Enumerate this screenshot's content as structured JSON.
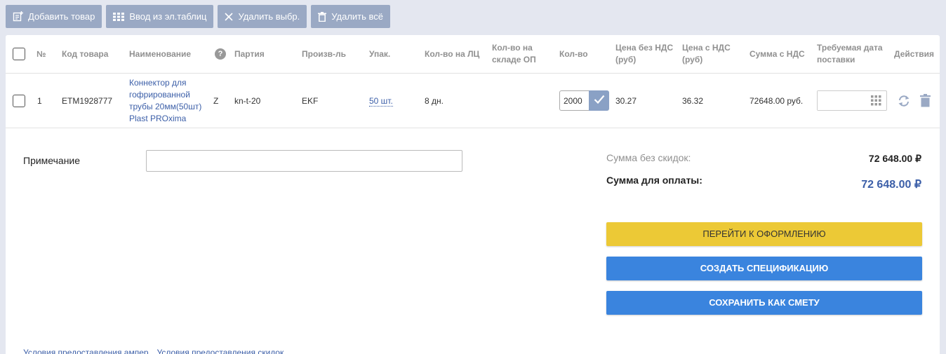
{
  "toolbar": {
    "add_label": "Добавить товар",
    "import_label": "Ввод из эл.таблиц",
    "delete_selected_label": "Удалить выбр.",
    "delete_all_label": "Удалить всё"
  },
  "table": {
    "headers": {
      "num": "№",
      "code": "Код товара",
      "name": "Наименование",
      "help": "?",
      "batch": "Партия",
      "manufacturer": "Произв-ль",
      "pack": "Упак.",
      "qty_lc": "Кол-во на ЛЦ",
      "qty_stock": "Кол-во на складе ОП",
      "qty": "Кол-во",
      "price_no_vat": "Цена без НДС (руб)",
      "price_vat": "Цена с НДС (руб)",
      "sum_vat": "Сумма с НДС",
      "delivery_date": "Требуемая дата поставки",
      "actions": "Действия"
    },
    "rows": [
      {
        "num": "1",
        "code": "ETM1928777",
        "name": "Коннектор для гофрированной трубы 20мм(50шт) Plast PROxima",
        "flag": "Z",
        "batch": "kn-t-20",
        "manufacturer": "EKF",
        "pack": "50 шт.",
        "qty_lc": "8 дн.",
        "qty_stock": "",
        "qty": "2000",
        "price_no_vat": "30.27",
        "price_vat": "36.32",
        "sum_vat": "72648.00 руб.",
        "delivery_date": ""
      }
    ]
  },
  "note": {
    "label": "Примечание",
    "value": ""
  },
  "summary": {
    "no_discount_label": "Сумма без скидок:",
    "no_discount_value": "72 648.00 ₽",
    "to_pay_label": "Сумма для оплаты:",
    "to_pay_value": "72 648.00 ₽"
  },
  "actions": {
    "checkout": "ПЕРЕЙТИ К ОФОРМЛЕНИЮ",
    "create_spec": "СОЗДАТЬ СПЕЦИФИКАЦИЮ",
    "save_estimate": "СОХРАНИТЬ КАК СМЕТУ"
  },
  "footer": {
    "link1": "Условия предоставления ампер",
    "link2": "Условия предоставления скидок"
  },
  "colors": {
    "toolbar_button": "#9aa9c4",
    "link": "#3c5fa8",
    "checkout": "#ecc936",
    "primary": "#3a84de"
  }
}
